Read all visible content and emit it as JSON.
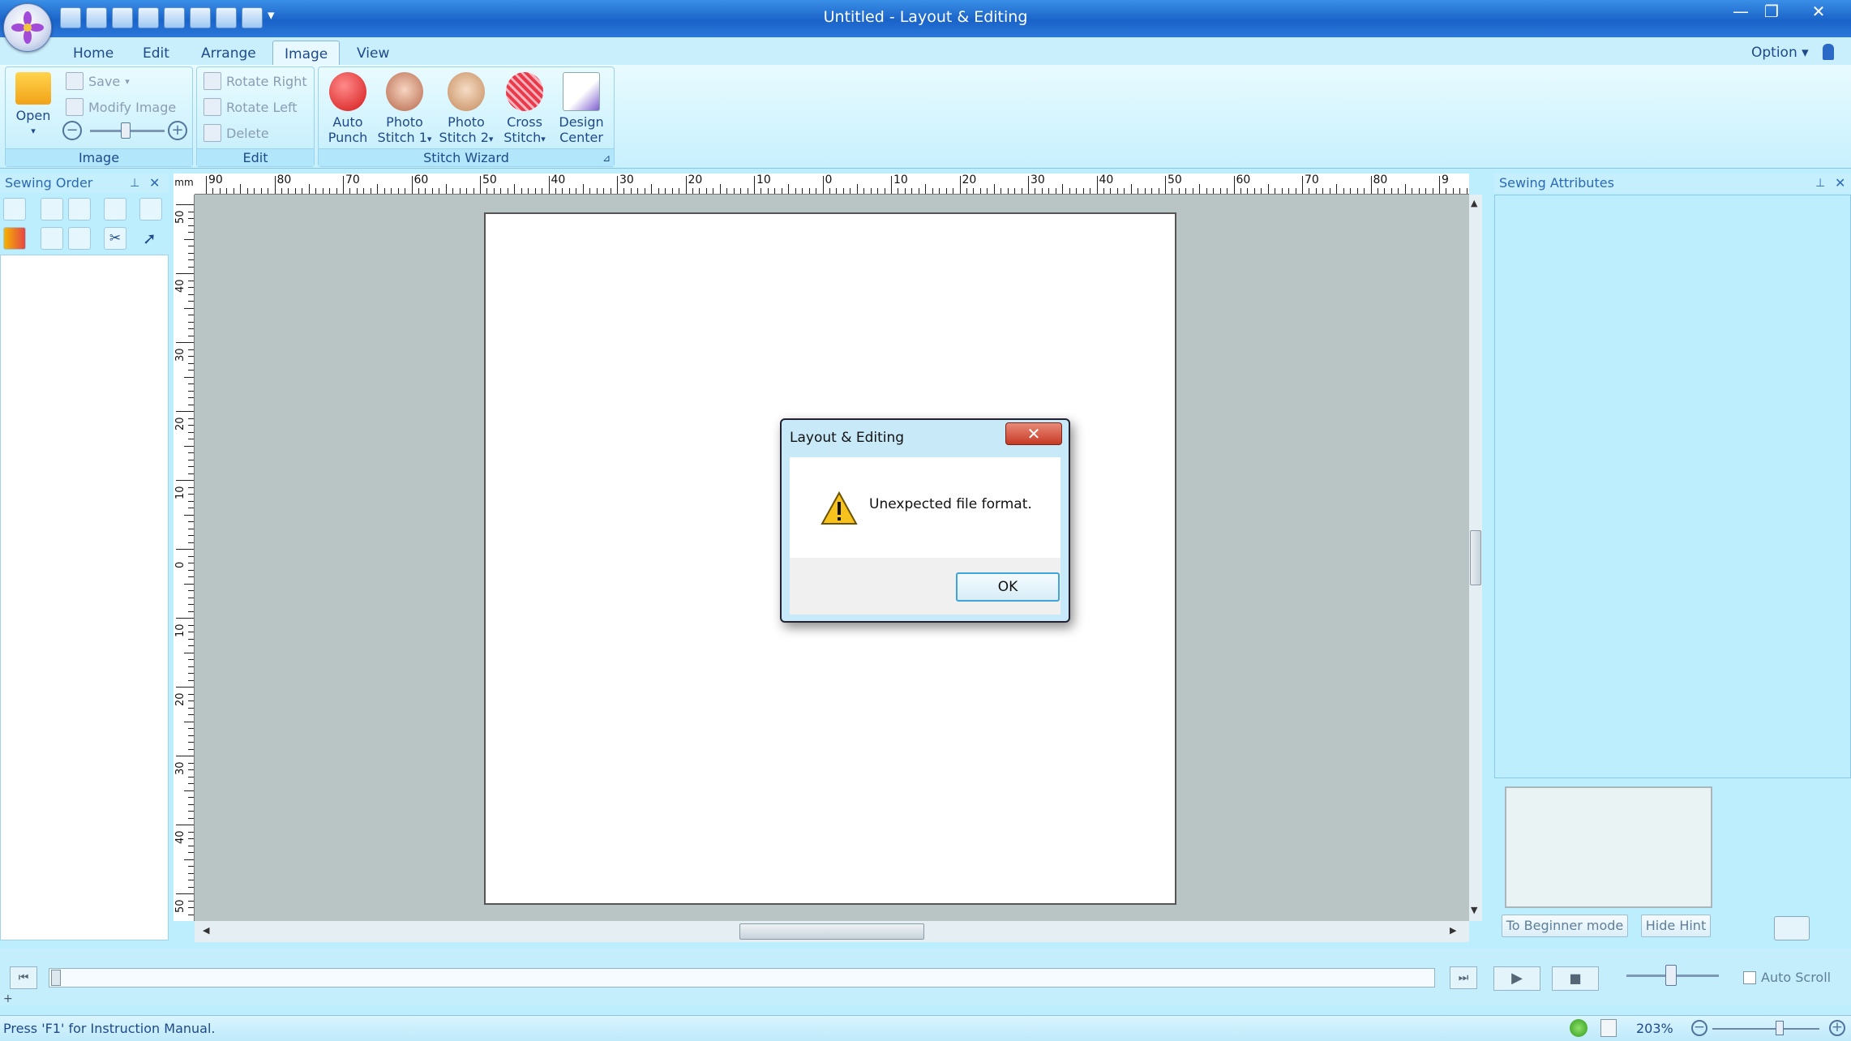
{
  "window": {
    "title": "Untitled - Layout & Editing",
    "min": "—",
    "restore": "❐",
    "close": "✕"
  },
  "tabs": [
    {
      "label": "Home"
    },
    {
      "label": "Edit"
    },
    {
      "label": "Arrange"
    },
    {
      "label": "Image"
    },
    {
      "label": "View"
    }
  ],
  "option_label": "Option",
  "ribbon": {
    "image_group": {
      "label": "Image",
      "open": "Open",
      "save": "Save",
      "modify": "Modify Image"
    },
    "edit_group": {
      "label": "Edit",
      "rotate_right": "Rotate Right",
      "rotate_left": "Rotate Left",
      "delete": "Delete"
    },
    "wizard_group": {
      "label": "Stitch Wizard",
      "auto_punch_1": "Auto",
      "auto_punch_2": "Punch",
      "photo1_1": "Photo",
      "photo1_2": "Stitch 1",
      "photo2_1": "Photo",
      "photo2_2": "Stitch 2",
      "cross_1": "Cross",
      "cross_2": "Stitch",
      "design_1": "Design",
      "design_2": "Center"
    }
  },
  "panels": {
    "sewing_order": "Sewing Order",
    "sewing_attributes": "Sewing Attributes"
  },
  "ruler": {
    "unit": "mm",
    "top_labels": [
      "90",
      "80",
      "70",
      "60",
      "50",
      "40",
      "30",
      "20",
      "10",
      "0",
      "10",
      "20",
      "30",
      "40",
      "50",
      "60",
      "70",
      "80",
      "9"
    ],
    "left_labels": [
      "50",
      "40",
      "30",
      "20",
      "10",
      "0",
      "10",
      "20",
      "30",
      "40",
      "50"
    ]
  },
  "dialog": {
    "title": "Layout & Editing",
    "message": "Unexpected file format.",
    "ok": "OK",
    "close": "✕"
  },
  "right_buttons": {
    "beginner": "To Beginner mode",
    "hide_hint": "Hide Hint"
  },
  "playbar": {
    "auto_scroll": "Auto Scroll"
  },
  "status": {
    "text": "Press 'F1' for Instruction Manual.",
    "zoom": "203%"
  }
}
